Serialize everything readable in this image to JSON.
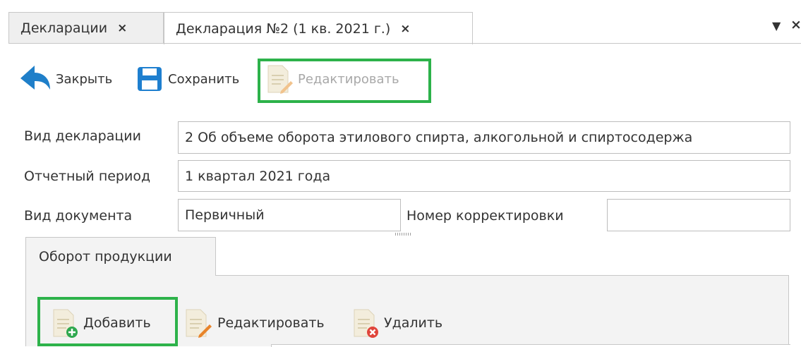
{
  "tabs": [
    {
      "label": "Декларации",
      "close": "×"
    },
    {
      "label": "Декларация №2 (1 кв. 2021 г.)",
      "close": "×"
    }
  ],
  "window_controls": {
    "menu": "▼",
    "close": "×"
  },
  "toolbar": {
    "close_label": "Закрыть",
    "save_label": "Сохранить",
    "edit_label": "Редактировать"
  },
  "form": {
    "decl_type": {
      "label": "Вид декларации",
      "value": "2 Об объеме оборота этилового спирта, алкогольной и спиртосодержа"
    },
    "period": {
      "label": "Отчетный период",
      "value": "1 квартал 2021 года"
    },
    "doc_type": {
      "label": "Вид документа",
      "value": "Первичный"
    },
    "correction": {
      "label": "Номер корректировки",
      "value": ""
    }
  },
  "inner_tab": {
    "label": "Оборот продукции"
  },
  "subtoolbar": {
    "add_label": "Добавить",
    "edit_label": "Редактировать",
    "delete_label": "Удалить"
  },
  "colors": {
    "highlight": "#2db24a",
    "back_arrow": "#1f7fc9",
    "save": "#1e7fcf"
  }
}
